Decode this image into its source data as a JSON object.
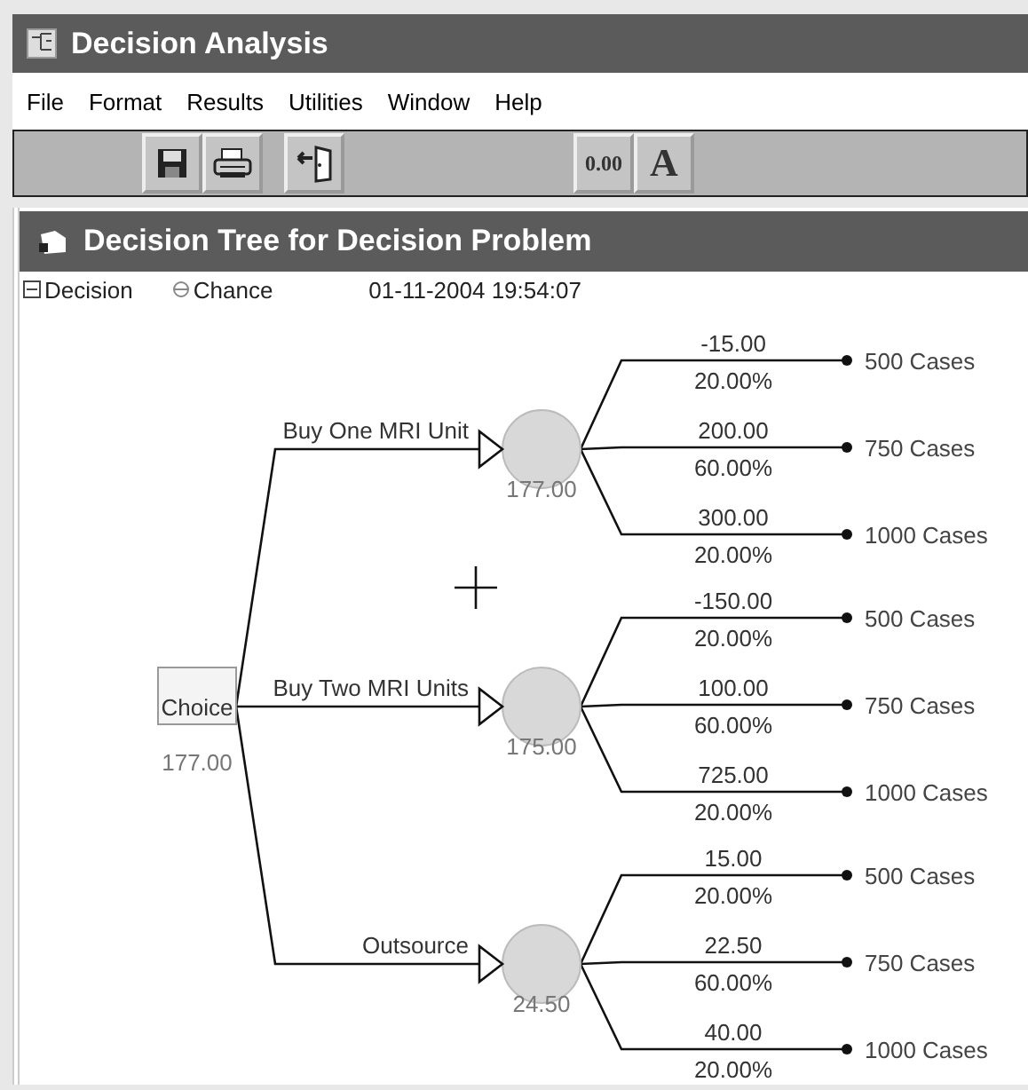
{
  "window": {
    "title": "Decision Analysis"
  },
  "menu": [
    "File",
    "Format",
    "Results",
    "Utilities",
    "Window",
    "Help"
  ],
  "toolbar": [
    {
      "kind": "save"
    },
    {
      "kind": "print"
    },
    {
      "kind": "exit"
    },
    {
      "kind": "decimals",
      "label": "0.00"
    },
    {
      "kind": "font",
      "label": "A"
    }
  ],
  "document": {
    "title": "Decision Tree for Decision Problem",
    "legend": [
      {
        "kind": "decision",
        "label": "Decision"
      },
      {
        "kind": "chance",
        "label": "Chance"
      }
    ],
    "timestamp": "01-11-2004  19:54:07",
    "tree": {
      "label": "Choice",
      "value": "177.00",
      "branches": [
        {
          "label": "Buy One MRI Unit",
          "value": "177.00",
          "outcomes": [
            {
              "payoff": "-15.00",
              "probability": "20.00%",
              "label": "500 Cases"
            },
            {
              "payoff": "200.00",
              "probability": "60.00%",
              "label": "750 Cases"
            },
            {
              "payoff": "300.00",
              "probability": "20.00%",
              "label": "1000 Cases"
            }
          ]
        },
        {
          "label": "Buy Two MRI Units",
          "value": "175.00",
          "outcomes": [
            {
              "payoff": "-150.00",
              "probability": "20.00%",
              "label": "500 Cases"
            },
            {
              "payoff": "100.00",
              "probability": "60.00%",
              "label": "750 Cases"
            },
            {
              "payoff": "725.00",
              "probability": "20.00%",
              "label": "1000 Cases"
            }
          ]
        },
        {
          "label": "Outsource",
          "value": "24.50",
          "outcomes": [
            {
              "payoff": "15.00",
              "probability": "20.00%",
              "label": "500 Cases"
            },
            {
              "payoff": "22.50",
              "probability": "60.00%",
              "label": "750 Cases"
            },
            {
              "payoff": "40.00",
              "probability": "20.00%",
              "label": "1000 Cases"
            }
          ]
        }
      ]
    }
  }
}
